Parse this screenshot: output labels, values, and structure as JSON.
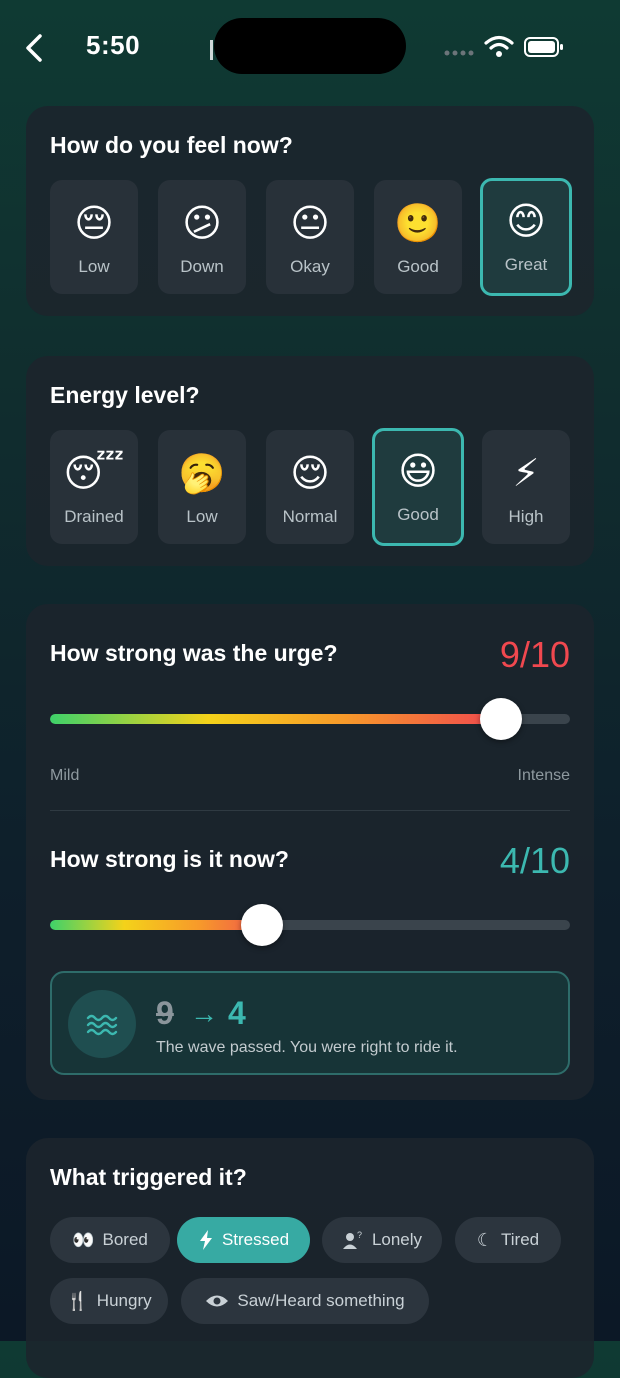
{
  "status_bar": {
    "time": "5:50"
  },
  "mood_card": {
    "title": "How do you feel now?",
    "options": [
      {
        "emoji": "😔",
        "label": "Low"
      },
      {
        "emoji": "😕",
        "label": "Down"
      },
      {
        "emoji": "😐",
        "label": "Okay"
      },
      {
        "emoji": "🙂",
        "label": "Good"
      },
      {
        "emoji": "😊",
        "label": "Great"
      }
    ],
    "selected": "Great"
  },
  "energy_card": {
    "title": "Energy level?",
    "options": [
      {
        "emoji": "😴",
        "label": "Drained"
      },
      {
        "emoji": "🥱",
        "label": "Low"
      },
      {
        "emoji": "😌",
        "label": "Normal"
      },
      {
        "emoji": "😃",
        "label": "Good"
      },
      {
        "emoji": "⚡",
        "label": "High"
      }
    ],
    "selected": "Good"
  },
  "urge_card": {
    "past": {
      "title": "How strong was the urge?",
      "score_text": "9/10",
      "value": 9,
      "max": 10,
      "min_label": "Mild",
      "max_label": "Intense"
    },
    "now": {
      "title": "How strong is it now?",
      "score_text": "4/10",
      "value": 4,
      "max": 10
    },
    "wave": {
      "from": "9",
      "arrow": "→",
      "to": "4",
      "message": "The wave passed. You were right to ride it."
    },
    "colors": {
      "past_score": "#f0484f",
      "now_score": "#3cb8b0",
      "accent": "#3cb8b0"
    }
  },
  "trigger_card": {
    "title": "What triggered it?",
    "chips": [
      {
        "icon": "eyes-icon",
        "glyph": "👀",
        "label": "Bored"
      },
      {
        "icon": "lightning-icon",
        "glyph": "⚡",
        "label": "Stressed"
      },
      {
        "icon": "person-question-icon",
        "glyph": "👤",
        "label": "Lonely"
      },
      {
        "icon": "moon-sleep-icon",
        "glyph": "☾",
        "label": "Tired"
      },
      {
        "icon": "fork-knife-icon",
        "glyph": "🍴",
        "label": "Hungry"
      },
      {
        "icon": "eye-icon",
        "glyph": "👁",
        "label": "Saw/Heard something"
      }
    ],
    "selected": "Stressed"
  }
}
